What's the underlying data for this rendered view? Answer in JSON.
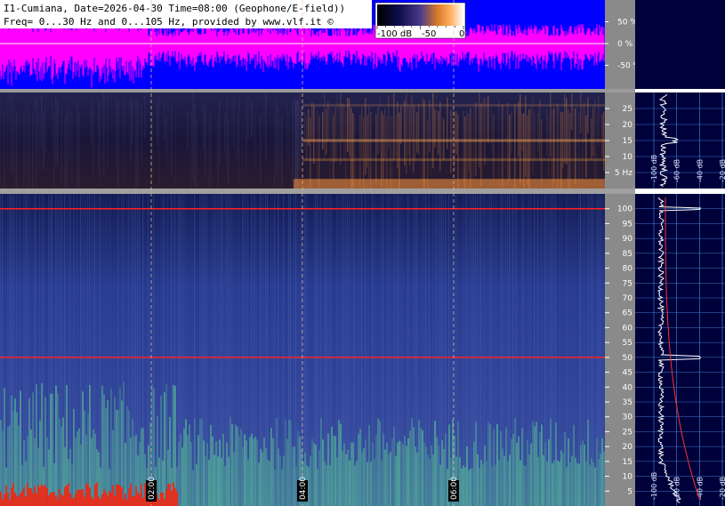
{
  "header": {
    "line1": "I1-Cumiana, Date=2026-04-30 Time=08:00 (Geophone/E-field))",
    "line2": "Freq= 0...30 Hz and 0...105 Hz, provided by www.vlf.it ©"
  },
  "colorbar": {
    "labels": [
      "-100 dB",
      "-50",
      "0"
    ]
  },
  "colors": {
    "waveform_bg": "#0000ff",
    "waveform_trace": "#ff00ff",
    "spectrogram_low": "#1a1440",
    "spectrogram_high": "#ff9a3c",
    "full_spectrogram_base": "#2b3a8c",
    "line_marker": "#ff2020",
    "side_panel_bg": "#00003a",
    "grid": "#3b7bc9"
  },
  "chart_data": [
    {
      "type": "line",
      "name": "waveform",
      "ylabel": "",
      "yticks": [
        "50 %",
        "0 %",
        "-50 %"
      ],
      "ylim": [
        -100,
        100
      ]
    },
    {
      "type": "heatmap",
      "name": "spectrogram 0-30 Hz",
      "yticks": [
        "25",
        "20",
        "15",
        "10",
        "5 Hz"
      ],
      "ylim": [
        0,
        30
      ],
      "xlim_hours": [
        0,
        8
      ],
      "xticks": [
        "02:00",
        "04:00",
        "06:00"
      ]
    },
    {
      "type": "heatmap",
      "name": "spectrogram 0-105 Hz",
      "yticks": [
        "100",
        "95",
        "90",
        "85",
        "80",
        "75",
        "70",
        "65",
        "60",
        "55",
        "50",
        "45",
        "40",
        "35",
        "30",
        "25",
        "20",
        "15",
        "10",
        "5"
      ],
      "ylim": [
        0,
        105
      ],
      "xlim_hours": [
        0,
        8
      ],
      "xticks": [
        "02:00",
        "04:00",
        "06:00"
      ],
      "marked_lines_hz": [
        50,
        100
      ]
    },
    {
      "type": "line",
      "name": "spectrum profile upper",
      "xticks": [
        "-100 dB",
        "-60 dB",
        "-40 dB",
        "-20 dB"
      ],
      "peaks_hz": [
        15
      ]
    },
    {
      "type": "line",
      "name": "spectrum profile lower",
      "xticks": [
        "-100 dB",
        "-60 dB",
        "-40 dB",
        "-20 dB"
      ],
      "peaks_hz": [
        50,
        100
      ]
    }
  ]
}
